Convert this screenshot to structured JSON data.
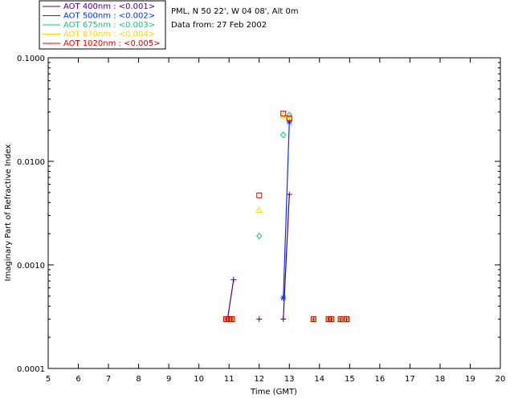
{
  "info": {
    "line1": "PML, N 50 22', W 04 08', Alt 0m",
    "line2": "Data from: 27 Feb 2002"
  },
  "legend": [
    {
      "label": "AOT  400nm : <0.001>",
      "color": "#4b0082"
    },
    {
      "label": "AOT  500nm : <0.002>",
      "color": "#0033ff"
    },
    {
      "label": "AOT  675nm : <0.003>",
      "color": "#00cc88"
    },
    {
      "label": "AOT  870nm : <0.004>",
      "color": "#ffd700"
    },
    {
      "label": "AOT 1020nm : <0.005>",
      "color": "#dd0000"
    }
  ],
  "chart_data": {
    "type": "scatter",
    "xlabel": "Time (GMT)",
    "ylabel": "Imaginary Part of Refractive Index",
    "xlim": [
      5,
      20
    ],
    "ylim": [
      0.0001,
      0.1
    ],
    "yscale": "log",
    "xticks": [
      "5",
      "6",
      "7",
      "8",
      "9",
      "10",
      "11",
      "12",
      "13",
      "14",
      "15",
      "16",
      "17",
      "18",
      "19",
      "20"
    ],
    "yticks": [
      "0.0001",
      "0.0010",
      "0.0100",
      "0.1000"
    ],
    "series": [
      {
        "color": "#4b0082",
        "marker": "plus",
        "x": [
          10.9,
          11.0,
          11.1,
          11.15,
          12.0,
          12.8,
          13.0,
          13.8,
          14.3,
          14.4,
          14.7,
          14.9
        ],
        "y": [
          0.0003,
          0.0003,
          0.0003,
          0.00072,
          0.0003,
          0.0003,
          0.0048,
          0.0003,
          0.0003,
          0.0003,
          0.0003,
          0.0003
        ],
        "line_segments": [
          [
            10.95,
            0.0003,
            11.15,
            0.00072
          ],
          [
            12.8,
            0.0003,
            13.0,
            0.0048
          ]
        ]
      },
      {
        "color": "#0033ff",
        "marker": "asterisk",
        "x": [
          12.8,
          13.0
        ],
        "y": [
          0.00048,
          0.024
        ],
        "line_segments": [
          [
            12.8,
            0.00048,
            13.0,
            0.024
          ]
        ]
      },
      {
        "color": "#00cc88",
        "marker": "diamond",
        "x": [
          10.9,
          11.0,
          11.1,
          12.0,
          12.8,
          13.0,
          13.8,
          14.3,
          14.4,
          14.7,
          14.9
        ],
        "y": [
          0.0003,
          0.0003,
          0.0003,
          0.0019,
          0.018,
          0.028,
          0.0003,
          0.0003,
          0.0003,
          0.0003,
          0.0003
        ]
      },
      {
        "color": "#ffd700",
        "marker": "triangle",
        "x": [
          10.9,
          11.0,
          11.1,
          12.0,
          12.8,
          13.0,
          13.8,
          14.3,
          14.4,
          14.7,
          14.9
        ],
        "y": [
          0.0003,
          0.0003,
          0.0003,
          0.0034,
          0.028,
          0.027,
          0.0003,
          0.0003,
          0.0003,
          0.0003,
          0.0003
        ]
      },
      {
        "color": "#dd0000",
        "marker": "square",
        "x": [
          10.9,
          11.0,
          11.1,
          12.0,
          12.8,
          13.0,
          13.8,
          14.3,
          14.4,
          14.7,
          14.9
        ],
        "y": [
          0.0003,
          0.0003,
          0.0003,
          0.0047,
          0.029,
          0.026,
          0.0003,
          0.0003,
          0.0003,
          0.0003,
          0.0003
        ]
      }
    ]
  }
}
